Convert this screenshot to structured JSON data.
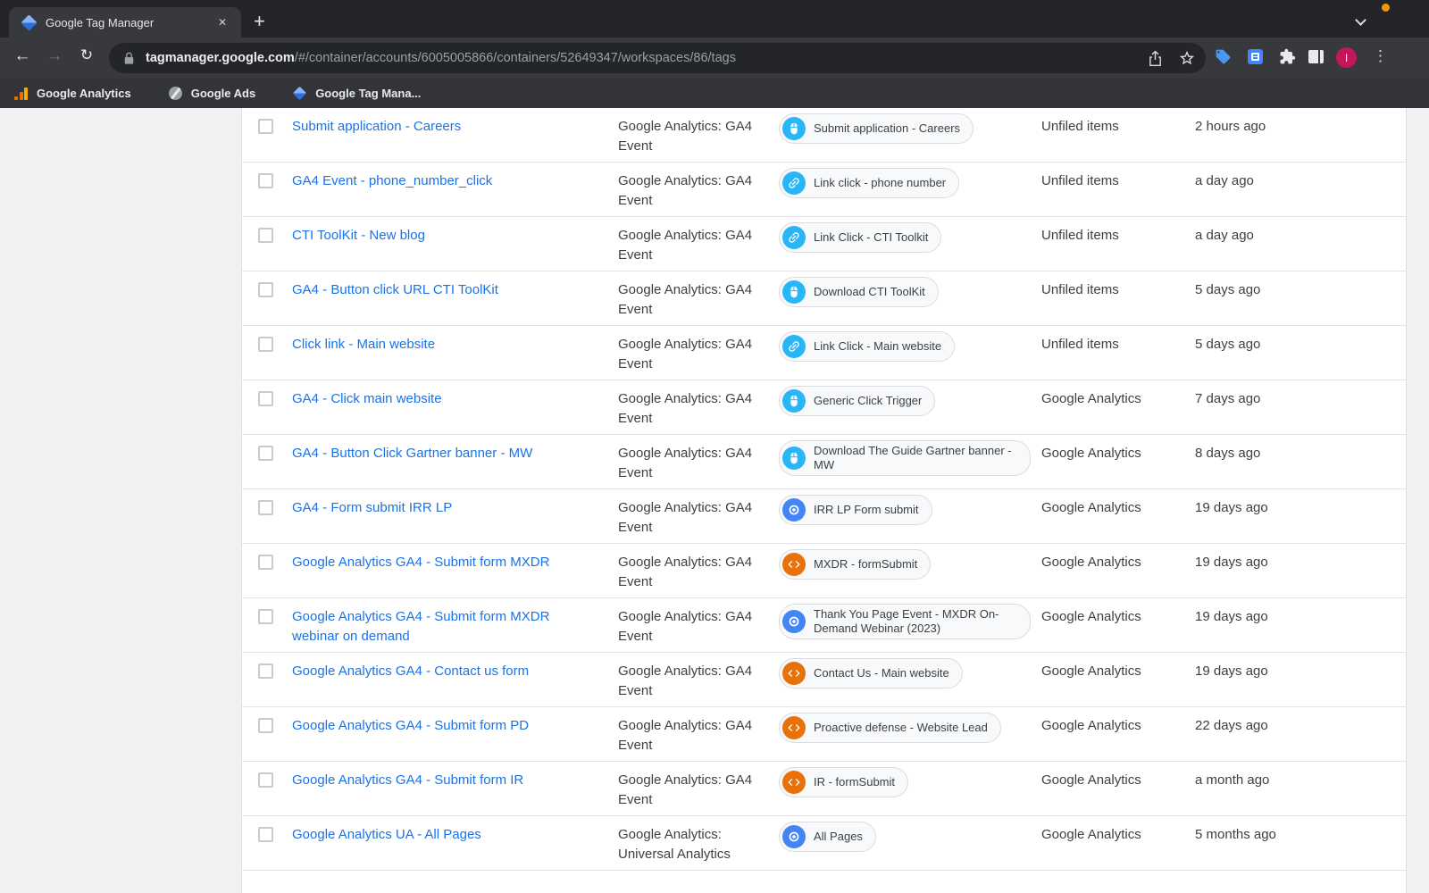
{
  "browser": {
    "tab_title": "Google Tag Manager",
    "icons": {
      "close": "✕",
      "new_tab": "+",
      "back": "←",
      "forward": "→",
      "reload": "↻",
      "menu": "⋮"
    },
    "url": {
      "host": "tagmanager.google.com",
      "path": "/#/container/accounts/6005005866/containers/52649347/workspaces/86/tags"
    },
    "avatar_letter": "I",
    "bookmarks": [
      {
        "label": "Google Analytics"
      },
      {
        "label": "Google Ads"
      },
      {
        "label": "Google Tag Mana..."
      }
    ]
  },
  "colors": {
    "link_blue": "#1a73e8",
    "trigger_click_blue": "#29b6f6",
    "trigger_pageview_blue": "#4285f4",
    "trigger_custom_event_orange": "#e8710a",
    "avatar_pink": "#c2185b"
  },
  "table": {
    "rows": [
      {
        "name": "Submit application - Careers",
        "type": "Google Analytics: GA4 Event",
        "trigger": {
          "label": "Submit application - Careers",
          "icon": "mouse"
        },
        "folder": "Unfiled items",
        "modified": "2 hours ago"
      },
      {
        "name": "GA4 Event - phone_number_click",
        "type": "Google Analytics: GA4 Event",
        "trigger": {
          "label": "Link click - phone number",
          "icon": "link"
        },
        "folder": "Unfiled items",
        "modified": "a day ago"
      },
      {
        "name": "CTI ToolKit - New blog",
        "type": "Google Analytics: GA4 Event",
        "trigger": {
          "label": "Link Click - CTI Toolkit",
          "icon": "link"
        },
        "folder": "Unfiled items",
        "modified": "a day ago"
      },
      {
        "name": "GA4 - Button click URL CTI ToolKit",
        "type": "Google Analytics: GA4 Event",
        "trigger": {
          "label": "Download CTI ToolKit",
          "icon": "mouse"
        },
        "folder": "Unfiled items",
        "modified": "5 days ago"
      },
      {
        "name": "Click link - Main website",
        "type": "Google Analytics: GA4 Event",
        "trigger": {
          "label": "Link Click - Main website",
          "icon": "link"
        },
        "folder": "Unfiled items",
        "modified": "5 days ago"
      },
      {
        "name": "GA4 - Click main website",
        "type": "Google Analytics: GA4 Event",
        "trigger": {
          "label": "Generic Click Trigger",
          "icon": "mouse"
        },
        "folder": "Google Analytics",
        "modified": "7 days ago"
      },
      {
        "name": "GA4 - Button Click Gartner banner - MW",
        "type": "Google Analytics: GA4 Event",
        "trigger": {
          "label": "Download The Guide Gartner banner - MW",
          "icon": "mouse"
        },
        "folder": "Google Analytics",
        "modified": "8 days ago"
      },
      {
        "name": "GA4 - Form submit IRR LP",
        "type": "Google Analytics: GA4 Event",
        "trigger": {
          "label": "IRR LP Form submit",
          "icon": "eye"
        },
        "folder": "Google Analytics",
        "modified": "19 days ago"
      },
      {
        "name": "Google Analytics GA4 - Submit form MXDR",
        "type": "Google Analytics: GA4 Event",
        "trigger": {
          "label": "MXDR - formSubmit",
          "icon": "code"
        },
        "folder": "Google Analytics",
        "modified": "19 days ago"
      },
      {
        "name": "Google Analytics GA4 - Submit form MXDR webinar on demand",
        "type": "Google Analytics: GA4 Event",
        "trigger": {
          "label": "Thank You Page Event - MXDR On-Demand Webinar (2023)",
          "icon": "eye"
        },
        "folder": "Google Analytics",
        "modified": "19 days ago"
      },
      {
        "name": "Google Analytics GA4 - Contact us form",
        "type": "Google Analytics: GA4 Event",
        "trigger": {
          "label": "Contact Us - Main website",
          "icon": "code"
        },
        "folder": "Google Analytics",
        "modified": "19 days ago"
      },
      {
        "name": "Google Analytics GA4 - Submit form PD",
        "type": "Google Analytics: GA4 Event",
        "trigger": {
          "label": "Proactive defense - Website Lead",
          "icon": "code"
        },
        "folder": "Google Analytics",
        "modified": "22 days ago"
      },
      {
        "name": "Google Analytics GA4 - Submit form IR",
        "type": "Google Analytics: GA4 Event",
        "trigger": {
          "label": "IR - formSubmit",
          "icon": "code"
        },
        "folder": "Google Analytics",
        "modified": "a month ago"
      },
      {
        "name": "Google Analytics UA - All Pages",
        "type": "Google Analytics: Universal Analytics",
        "trigger": {
          "label": "All Pages",
          "icon": "eye"
        },
        "folder": "Google Analytics",
        "modified": "5 months ago"
      }
    ]
  }
}
